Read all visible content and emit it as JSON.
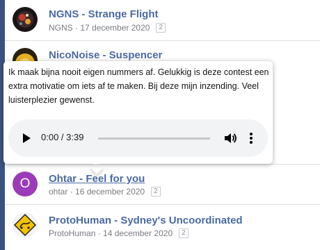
{
  "entries": [
    {
      "title": "NGNS - Strange Flight",
      "author": "NGNS",
      "date": "17 december 2020",
      "replies": "2",
      "avatar_icon": "ngns-avatar"
    },
    {
      "title": "NicoNoise - Suspencer",
      "avatar_icon": "niconoise-avatar"
    },
    {
      "title": "Ohtar - Feel for you",
      "author": "ohtar",
      "date": "16 december 2020",
      "replies": "2",
      "avatar_letter": "O",
      "avatar_color": "#9b3bb8"
    },
    {
      "title": "ProtoHuman - Sydney's Uncoordinated",
      "author": "ProtoHuman",
      "date": "14 december 2020",
      "replies": "2",
      "avatar_icon": "warning-sign-avatar"
    }
  ],
  "separator": " · ",
  "tooltip": {
    "text": "Ik maak bijna nooit eigen nummers af. Gelukkig is deze contest een extra motivatie om iets af te maken. Bij deze mijn inzending. Veel luisterplezier gewenst.",
    "player": {
      "time": "0:00 / 3:39",
      "progress": 0
    }
  },
  "colors": {
    "accent": "#4a6aa5",
    "sidebar": "#3b5280",
    "player_bg": "#f1f3f4"
  }
}
